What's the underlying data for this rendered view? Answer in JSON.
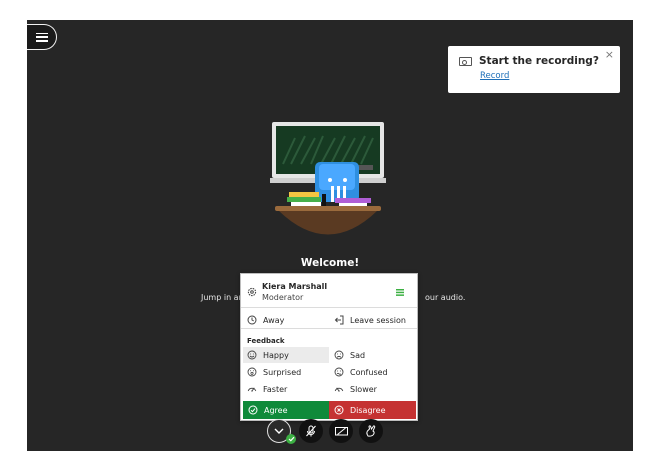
{
  "toast": {
    "title": "Start the recording?",
    "link": "Record",
    "close": "×"
  },
  "welcome": {
    "title": "Welcome!",
    "line_left": "Jump in ar",
    "line_right": "our audio."
  },
  "user": {
    "name": "Kiera Marshall",
    "role": "Moderator"
  },
  "status": {
    "away": "Away",
    "leave": "Leave session"
  },
  "feedback": {
    "label": "Feedback",
    "happy": "Happy",
    "sad": "Sad",
    "surprised": "Surprised",
    "confused": "Confused",
    "faster": "Faster",
    "slower": "Slower",
    "agree": "Agree",
    "disagree": "Disagree"
  },
  "colors": {
    "stage": "#262626",
    "agree": "#0f8a3a",
    "disagree": "#c53232",
    "link": "#1e6fb8",
    "status_green": "#3cb043"
  },
  "icons": [
    "menu-icon",
    "camera-icon",
    "close-icon",
    "gear-icon",
    "grid-status-icon",
    "clock-icon",
    "exit-icon",
    "happy-face-icon",
    "sad-face-icon",
    "surprised-face-icon",
    "confused-face-icon",
    "faster-icon",
    "slower-icon",
    "check-circle-icon",
    "x-circle-icon",
    "chevron-down-icon",
    "mic-off-icon",
    "camera-off-icon",
    "hand-icon"
  ]
}
